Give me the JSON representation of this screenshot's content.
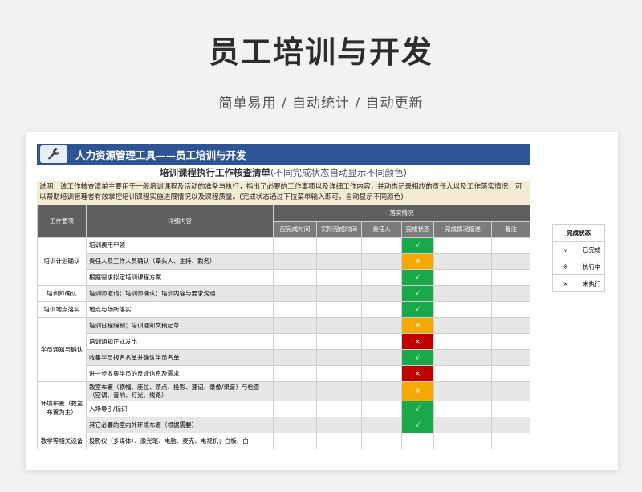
{
  "hero": {
    "title": "员工培训与开发",
    "subtitle": "简单易用  /  自动统计  /  自动更新"
  },
  "sheet": {
    "banner": "人力资源管理工具——员工培训与开发",
    "subtitle": "培训课程执行工作核查清单",
    "subtitle_note": "(不同完成状态自动显示不同颜色)",
    "description": "说明：该工作核查清单主要用于一般培训课程及活动的准备与执行，指出了必要的工作事项以及详细工作内容，并动态记录相应的责任人以及工作落实情况，可以帮助培训管理者有效掌控培训课程实施进展情况以及课程质量。(完成状态通过下拉菜单输入即可，自动显示不同颜色)",
    "headers": {
      "item": "工作要项",
      "detail": "详细内容",
      "group": "落实情况",
      "planned": "应完成时间",
      "actual": "实际完成时间",
      "owner": "责任人",
      "status": "完成状态",
      "status_desc": "完成情况描述",
      "note": "备注"
    },
    "groups": [
      {
        "category": "培训计划确认",
        "rows": [
          {
            "detail": "培训费用申领",
            "status": "√",
            "color": "#19a84a"
          },
          {
            "detail": "责任人及工作人员确认（牵头人、主持、教务）",
            "status": "※",
            "color": "#f5a800"
          },
          {
            "detail": "根据需求拟定培训课程方案",
            "status": "√",
            "color": "#19a84a"
          }
        ]
      },
      {
        "category": "培训师确认",
        "rows": [
          {
            "detail": "培训师邀请；培训师确认；培训内容与要求沟通",
            "status": "√",
            "color": "#19a84a"
          }
        ]
      },
      {
        "category": "培训地点落实",
        "rows": [
          {
            "detail": "地点与场所落实",
            "status": "√",
            "color": "#19a84a"
          }
        ]
      },
      {
        "category": "学员通知与确认",
        "rows": [
          {
            "detail": "培训日程编制；培训通知文稿起草",
            "status": "※",
            "color": "#f5a800"
          },
          {
            "detail": "培训通知正式发出",
            "status": "×",
            "color": "#c00000"
          },
          {
            "detail": "收集学员报名名单并确认学员名单",
            "status": "√",
            "color": "#19a84a"
          },
          {
            "detail": "进一步收集学员的反馈信息及需求",
            "status": "×",
            "color": "#c00000"
          }
        ]
      },
      {
        "category": "环境布置（教室布置为主）",
        "rows": [
          {
            "detail": "教室布置（横幅、座位、茶点、投影、速记、录像/录音）与检查（空调、音响、灯光、线路）",
            "status": "※",
            "color": "#f5a800",
            "tall": true
          },
          {
            "detail": "入场导引/标识",
            "status": "√",
            "color": "#19a84a"
          },
          {
            "detail": "其它必要的室内外环境布置（根据需要）",
            "status": "√",
            "color": "#19a84a"
          }
        ]
      },
      {
        "category": "教学等相关设备",
        "rows": [
          {
            "detail": "投影仪（多媒体）、激光笔、电脑、麦克、电视机；白板、白",
            "status": "",
            "color": "#ffffff"
          }
        ]
      }
    ],
    "legend": {
      "header": "完成状态",
      "items": [
        {
          "symbol": "√",
          "label": "已完成"
        },
        {
          "symbol": "※",
          "label": "执行中"
        },
        {
          "symbol": "×",
          "label": "未执行"
        }
      ]
    }
  }
}
